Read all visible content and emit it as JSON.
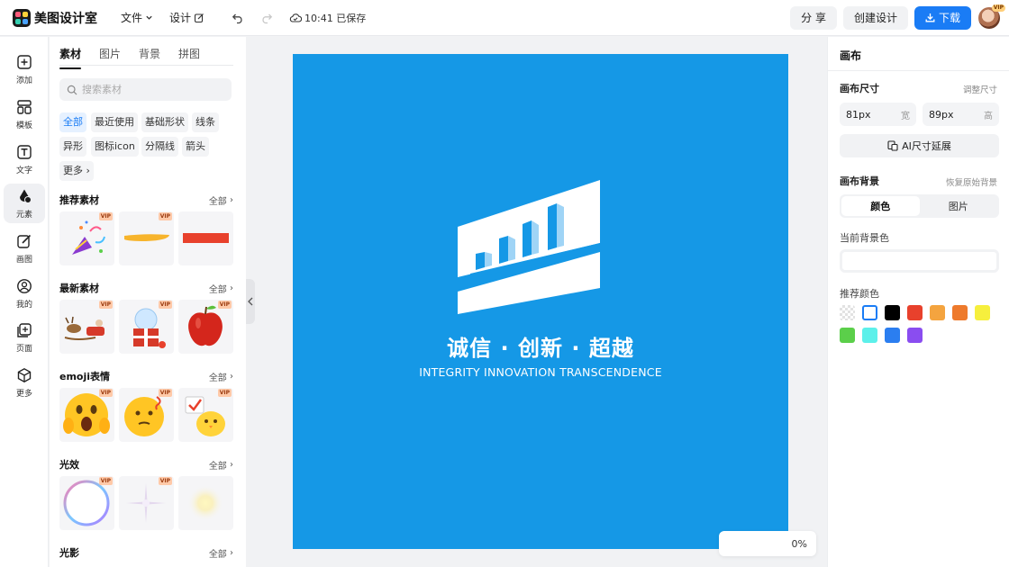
{
  "app": {
    "name": "美图设计室"
  },
  "topbar": {
    "menu": [
      {
        "label": "文件",
        "icon": "chevron-down-icon"
      },
      {
        "label": "设计",
        "icon": "edit-icon"
      }
    ],
    "save_status": "10:41 已保存",
    "share_label": "分 享",
    "create_label": "创建设计",
    "download_label": "下载",
    "avatar_badge": "VIP"
  },
  "rail": {
    "items": [
      {
        "label": "添加",
        "icon": "plus-square-icon"
      },
      {
        "label": "模板",
        "icon": "template-icon"
      },
      {
        "label": "文字",
        "icon": "text-icon"
      },
      {
        "label": "元素",
        "icon": "element-icon",
        "active": true
      },
      {
        "label": "画图",
        "icon": "draw-icon"
      },
      {
        "label": "我的",
        "icon": "user-icon"
      },
      {
        "label": "页面",
        "icon": "page-add-icon"
      },
      {
        "label": "更多",
        "icon": "cube-icon"
      }
    ]
  },
  "panel": {
    "tabs": [
      "素材",
      "图片",
      "背景",
      "拼图"
    ],
    "search_placeholder": "搜索素材",
    "chips": [
      "全部",
      "最近使用",
      "基础形状",
      "线条",
      "异形",
      "图标icon",
      "分隔线",
      "箭头",
      "更多"
    ],
    "sections": [
      {
        "title": "推荐素材",
        "all": "全部"
      },
      {
        "title": "最新素材",
        "all": "全部"
      },
      {
        "title": "emoji表情",
        "all": "全部"
      },
      {
        "title": "光效",
        "all": "全部"
      },
      {
        "title": "光影",
        "all": "全部"
      }
    ],
    "vip_label": "VIP"
  },
  "canvas": {
    "background_color": "#1598e6",
    "slogan_cn": "诚信 · 创新 · 超越",
    "slogan_en": "INTEGRITY  INNOVATION TRANSCENDENCE",
    "zoom_label": "0%"
  },
  "props": {
    "title": "画布",
    "size_label": "画布尺寸",
    "size_link": "调整尺寸",
    "width_value": "81px",
    "width_unit": "宽",
    "height_value": "89px",
    "height_unit": "高",
    "ai_extend_label": "AI尺寸延展",
    "bg_label": "画布背景",
    "bg_reset": "恢复原始背景",
    "bg_modes": [
      "颜色",
      "图片"
    ],
    "current_bg_label": "当前背景色",
    "recommended_label": "推荐颜色",
    "swatches": [
      "transparent",
      "#ffffff",
      "#000000",
      "#e8412c",
      "#f4a43f",
      "#ee7a2c",
      "#f6ef3d",
      "#5bcf4a",
      "#5cf0ea",
      "#2b7ef0",
      "#8a4df0"
    ]
  },
  "colors": {
    "accent": "#1a7cf5",
    "canvas_blue": "#1598e6"
  }
}
